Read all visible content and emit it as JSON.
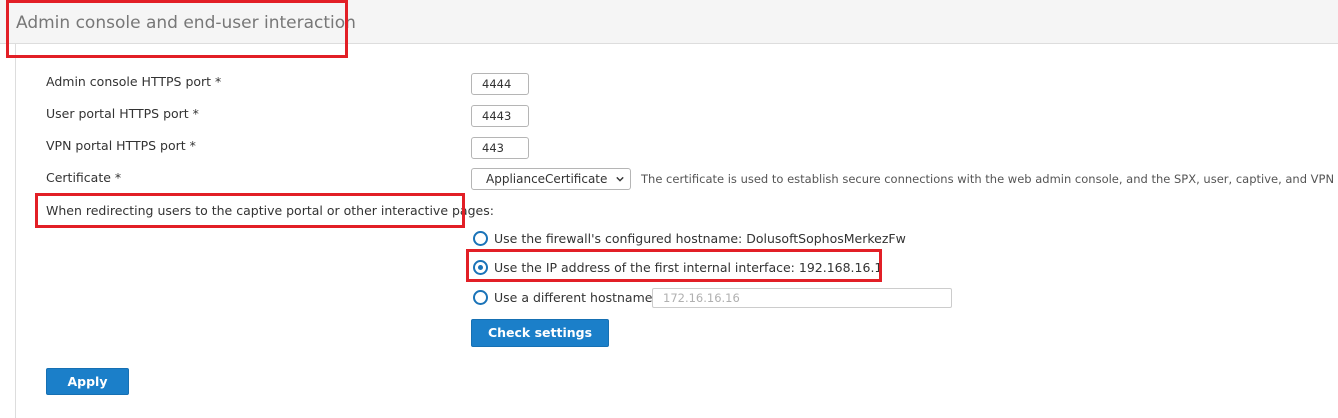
{
  "section": {
    "title": "Admin console and end-user interaction"
  },
  "fields": {
    "admin_port_label": "Admin console HTTPS port *",
    "admin_port_value": "4444",
    "user_port_label": "User portal HTTPS port *",
    "user_port_value": "4443",
    "vpn_port_label": "VPN portal HTTPS port *",
    "vpn_port_value": "443",
    "certificate_label": "Certificate *",
    "certificate_value": "ApplianceCertificate",
    "certificate_description": "The certificate is used to establish secure connections with the web admin console, and the SPX, user, captive, and VPN portals."
  },
  "redirect": {
    "label": "When redirecting users to the captive portal or other interactive pages:",
    "options": [
      {
        "label": "Use the firewall's configured hostname:  DolusoftSophosMerkezFw",
        "checked": false
      },
      {
        "label": "Use the IP address of the first internal interface:  192.168.16.1",
        "checked": true
      },
      {
        "label": "Use a different hostname:",
        "checked": false
      }
    ],
    "hostname_placeholder": "172.16.16.16"
  },
  "buttons": {
    "check_settings": "Check settings",
    "apply": "Apply"
  },
  "colors": {
    "accent": "#1b7fc9",
    "highlight": "#e21f26"
  }
}
